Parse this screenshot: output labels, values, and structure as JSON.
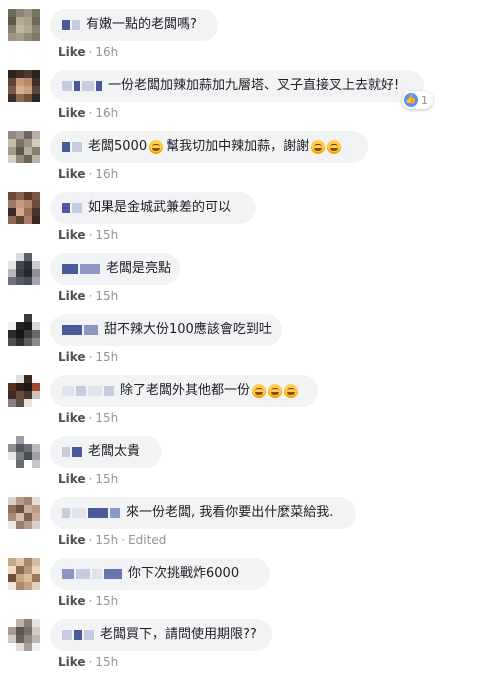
{
  "colors": {
    "bubble_bg": "#f2f3f5",
    "text": "#1c1e21",
    "meta_text": "#90949c",
    "like_text": "#4b4f56",
    "redaction_dark": "#4a5a9a",
    "redaction_light": "#c6cbe0",
    "reaction_blue": "#5890ff"
  },
  "like_label": "Like",
  "comments": [
    {
      "text": "有嫩一點的老闆嗎?",
      "time": "16h",
      "edited": ""
    },
    {
      "text": "一份老闆加辣加蒜加九層塔、叉子直接叉上去就好!",
      "time": "16h",
      "edited": "",
      "reaction": {
        "icon": "thumbs-up-icon",
        "count": "1"
      }
    },
    {
      "text": "老闆5000",
      "text2": "幫我切加中辣加蒜，謝謝",
      "emoji_name": "laughing-face-icon",
      "time": "16h",
      "edited": ""
    },
    {
      "text": "如果是金城武兼差的可以",
      "time": "15h",
      "edited": ""
    },
    {
      "text": "老闆是亮點",
      "time": "15h",
      "edited": ""
    },
    {
      "text": "甜不辣大份100應該會吃到吐",
      "time": "15h",
      "edited": ""
    },
    {
      "text": "除了老闆外其他都一份",
      "emoji_name": "steam-face-icon",
      "time": "15h",
      "edited": ""
    },
    {
      "text": "老闆太貴",
      "time": "15h",
      "edited": ""
    },
    {
      "text": "來一份老闆, 我看你要出什麼菜給我.",
      "time": "15h",
      "edited": "Edited"
    },
    {
      "text": "你下次挑戰炸6000",
      "time": "15h",
      "edited": ""
    },
    {
      "text": "老闆買下，請問使用期限??",
      "time": "15h",
      "edited": ""
    }
  ]
}
